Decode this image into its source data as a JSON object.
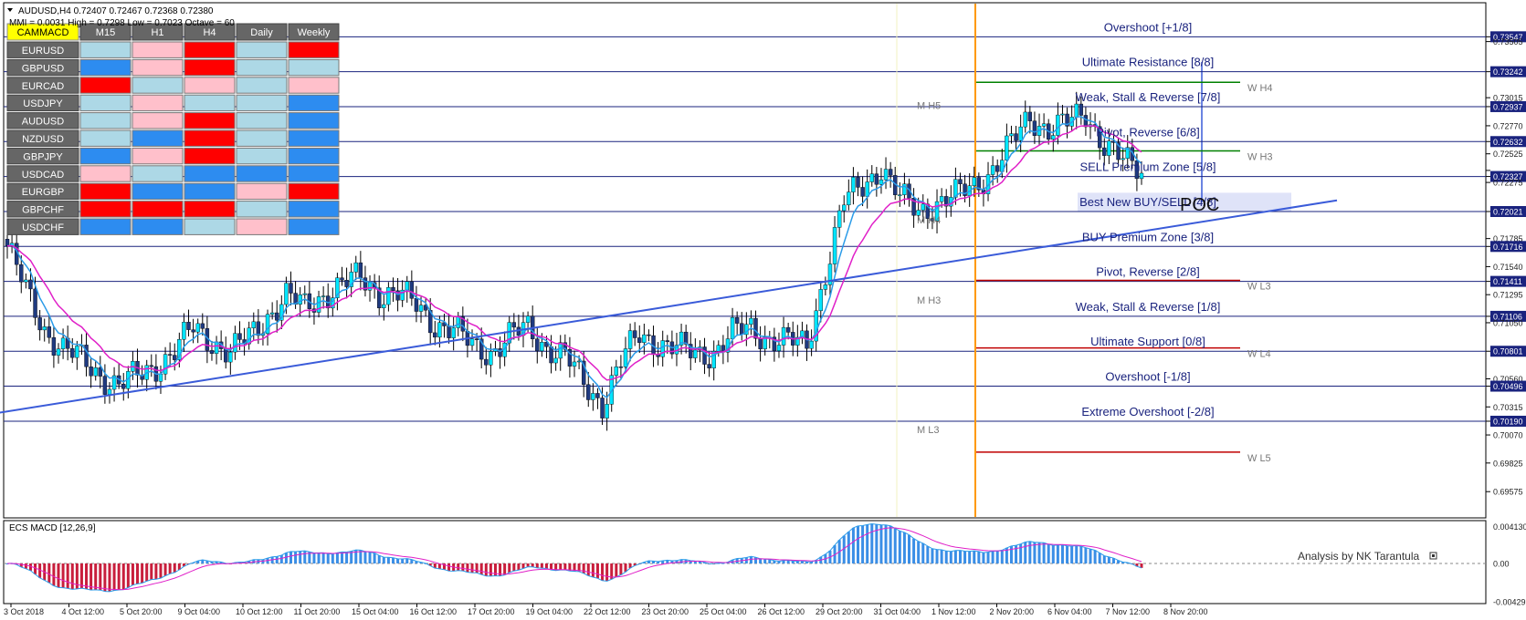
{
  "header": {
    "symbol_line": "AUDUSD,H4  0.72407 0.72467 0.72368 0.72380",
    "mmi_line": "MMI = 0.0031   High = 0.7298   Low = 0.7023   Octave = 60"
  },
  "matrix": {
    "corner_label": "CAMMACD",
    "columns": [
      "M15",
      "H1",
      "H4",
      "Daily",
      "Weekly"
    ],
    "rows": [
      {
        "pair": "EURUSD",
        "cells": [
          "lightblue",
          "pink",
          "red",
          "lightblue",
          "red"
        ]
      },
      {
        "pair": "GBPUSD",
        "cells": [
          "blue",
          "pink",
          "red",
          "lightblue",
          "lightblue"
        ]
      },
      {
        "pair": "EURCAD",
        "cells": [
          "red",
          "lightblue",
          "pink",
          "lightblue",
          "pink"
        ]
      },
      {
        "pair": "USDJPY",
        "cells": [
          "lightblue",
          "pink",
          "lightblue",
          "lightblue",
          "blue"
        ]
      },
      {
        "pair": "AUDUSD",
        "cells": [
          "lightblue",
          "pink",
          "red",
          "lightblue",
          "blue"
        ]
      },
      {
        "pair": "NZDUSD",
        "cells": [
          "lightblue",
          "blue",
          "red",
          "lightblue",
          "blue"
        ]
      },
      {
        "pair": "GBPJPY",
        "cells": [
          "blue",
          "pink",
          "red",
          "lightblue",
          "blue"
        ]
      },
      {
        "pair": "USDCAD",
        "cells": [
          "pink",
          "lightblue",
          "blue",
          "blue",
          "blue"
        ]
      },
      {
        "pair": "EURGBP",
        "cells": [
          "red",
          "blue",
          "blue",
          "pink",
          "red"
        ]
      },
      {
        "pair": "GBPCHF",
        "cells": [
          "red",
          "red",
          "red",
          "lightblue",
          "blue"
        ]
      },
      {
        "pair": "USDCHF",
        "cells": [
          "blue",
          "blue",
          "lightblue",
          "pink",
          "blue"
        ]
      }
    ]
  },
  "colors": {
    "lightblue": "#add8e6",
    "pink": "#ffc0cb",
    "red": "#ff0000",
    "blue": "#2d8cf0",
    "bull": "#00e5ff",
    "bear": "#1f3a80",
    "fast_ma": "#2b9be8",
    "slow_ma": "#e020c8",
    "murrey_line": "#1a237e",
    "trendline": "#3a5bd9",
    "vline": "#ff9900",
    "w_green": "#008000",
    "w_red": "#c00000",
    "hist_pos": "#3a8ee6",
    "hist_neg": "#c81e3c",
    "poc_zone": "#dfe3f8"
  },
  "chart_data": {
    "type": "candlestick",
    "symbol": "AUDUSD",
    "timeframe": "H4",
    "ylim": [
      0.6961,
      0.7362
    ],
    "price_ticks": [
      {
        "value": 0.73547,
        "label": "0.73547",
        "tag": true
      },
      {
        "value": 0.73505,
        "label": "0.73505",
        "tag": false
      },
      {
        "value": 0.73242,
        "label": "0.73242",
        "tag": true
      },
      {
        "value": 0.73015,
        "label": "0.73015",
        "tag": false
      },
      {
        "value": 0.72937,
        "label": "0.72937",
        "tag": true
      },
      {
        "value": 0.7277,
        "label": "0.72770",
        "tag": false
      },
      {
        "value": 0.72632,
        "label": "0.72632",
        "tag": true
      },
      {
        "value": 0.72525,
        "label": "0.72525",
        "tag": false
      },
      {
        "value": 0.7238,
        "label": "0.72380",
        "tag": true
      },
      {
        "value": 0.72327,
        "label": "0.72327",
        "tag": true
      },
      {
        "value": 0.72275,
        "label": "0.72275",
        "tag": false
      },
      {
        "value": 0.72021,
        "label": "0.72021",
        "tag": true
      },
      {
        "value": 0.71785,
        "label": "0.71785",
        "tag": false
      },
      {
        "value": 0.71716,
        "label": "0.71716",
        "tag": true
      },
      {
        "value": 0.7154,
        "label": "0.71540",
        "tag": false
      },
      {
        "value": 0.71411,
        "label": "0.71411",
        "tag": true
      },
      {
        "value": 0.71295,
        "label": "0.71295",
        "tag": false
      },
      {
        "value": 0.71106,
        "label": "0.71106",
        "tag": true
      },
      {
        "value": 0.7105,
        "label": "0.71050",
        "tag": false
      },
      {
        "value": 0.70801,
        "label": "0.70801",
        "tag": true
      },
      {
        "value": 0.7056,
        "label": "0.70560",
        "tag": false
      },
      {
        "value": 0.70496,
        "label": "0.70496",
        "tag": true
      },
      {
        "value": 0.70315,
        "label": "0.70315",
        "tag": false
      },
      {
        "value": 0.7019,
        "label": "0.70190",
        "tag": true
      },
      {
        "value": 0.7007,
        "label": "0.70070",
        "tag": false
      },
      {
        "value": 0.69825,
        "label": "0.69825",
        "tag": false
      },
      {
        "value": 0.69575,
        "label": "0.69575",
        "tag": false
      }
    ],
    "murrey_levels": [
      {
        "label": "Overshoot [+1/8]",
        "value": 0.73547
      },
      {
        "label": "Ultimate Resistance [8/8]",
        "value": 0.73242
      },
      {
        "label": "Weak, Stall & Reverse [7/8]",
        "value": 0.72937
      },
      {
        "label": "Pivot, Reverse [6/8]",
        "value": 0.72632
      },
      {
        "label": "SELL Premium Zone [5/8]",
        "value": 0.72327
      },
      {
        "label": "Best New BUY/SELL [4/8]",
        "value": 0.72021
      },
      {
        "label": "BUY Premium Zone [3/8]",
        "value": 0.71716
      },
      {
        "label": "Pivot, Reverse [2/8]",
        "value": 0.71411
      },
      {
        "label": "Weak, Stall & Reverse [1/8]",
        "value": 0.71106
      },
      {
        "label": "Ultimate Support [0/8]",
        "value": 0.70801
      },
      {
        "label": "Overshoot [-1/8]",
        "value": 0.70496
      },
      {
        "label": "Extreme Overshoot [-2/8]",
        "value": 0.7019
      }
    ],
    "weekly_levels": [
      {
        "label": "W H4",
        "value": 0.7315,
        "color": "green"
      },
      {
        "label": "W H3",
        "value": 0.7255,
        "color": "green"
      },
      {
        "label": "W L3",
        "value": 0.7142,
        "color": "red"
      },
      {
        "label": "W L4",
        "value": 0.7083,
        "color": "red"
      },
      {
        "label": "W L5",
        "value": 0.6992,
        "color": "red"
      }
    ],
    "monthly_labels": [
      {
        "label": "M H5",
        "value": 0.7295
      },
      {
        "label": "M H4",
        "value": 0.7195
      },
      {
        "label": "M H3",
        "value": 0.7125
      },
      {
        "label": "M L3",
        "value": 0.7012
      }
    ],
    "poc_label": "POC",
    "poc_zone": [
      0.72021,
      0.72185
    ],
    "trendline": {
      "from": [
        "26 Oct 04:00",
        0.7018
      ],
      "to": [
        "8 Nov 20:00",
        0.7215
      ]
    },
    "current_price": 0.7238,
    "x_labels": [
      "3 Oct 2018",
      "4 Oct 12:00",
      "5 Oct 20:00",
      "9 Oct 04:00",
      "10 Oct 12:00",
      "11 Oct 20:00",
      "15 Oct 04:00",
      "16 Oct 12:00",
      "17 Oct 20:00",
      "19 Oct 04:00",
      "22 Oct 12:00",
      "23 Oct 20:00",
      "25 Oct 04:00",
      "26 Oct 12:00",
      "29 Oct 20:00",
      "31 Oct 04:00",
      "1 Nov 12:00",
      "2 Nov 20:00",
      "6 Nov 04:00",
      "7 Nov 12:00",
      "8 Nov 20:00"
    ],
    "close_path": [
      [
        0,
        0.7172
      ],
      [
        4,
        0.7132
      ],
      [
        8,
        0.71
      ],
      [
        12,
        0.7082
      ],
      [
        16,
        0.7072
      ],
      [
        20,
        0.706
      ],
      [
        24,
        0.705
      ],
      [
        28,
        0.7058
      ],
      [
        32,
        0.7068
      ],
      [
        36,
        0.708
      ],
      [
        40,
        0.71
      ],
      [
        44,
        0.709
      ],
      [
        48,
        0.7078
      ],
      [
        52,
        0.7092
      ],
      [
        56,
        0.7112
      ],
      [
        60,
        0.7128
      ],
      [
        64,
        0.7118
      ],
      [
        68,
        0.713
      ],
      [
        72,
        0.7138
      ],
      [
        76,
        0.7144
      ],
      [
        80,
        0.7132
      ],
      [
        84,
        0.713
      ],
      [
        88,
        0.712
      ],
      [
        92,
        0.7105
      ],
      [
        96,
        0.7098
      ],
      [
        100,
        0.7085
      ],
      [
        104,
        0.708
      ],
      [
        108,
        0.7092
      ],
      [
        112,
        0.71
      ],
      [
        116,
        0.7085
      ],
      [
        120,
        0.7075
      ],
      [
        124,
        0.7052
      ],
      [
        128,
        0.7035
      ],
      [
        132,
        0.707
      ],
      [
        136,
        0.7095
      ],
      [
        140,
        0.7088
      ],
      [
        144,
        0.7082
      ],
      [
        148,
        0.7078
      ],
      [
        152,
        0.708
      ],
      [
        156,
        0.7095
      ],
      [
        160,
        0.71
      ],
      [
        164,
        0.7092
      ],
      [
        168,
        0.7088
      ],
      [
        172,
        0.7085
      ],
      [
        176,
        0.715
      ],
      [
        180,
        0.721
      ],
      [
        184,
        0.7225
      ],
      [
        188,
        0.7242
      ],
      [
        192,
        0.7213
      ],
      [
        196,
        0.7203
      ],
      [
        200,
        0.721
      ],
      [
        204,
        0.7215
      ],
      [
        208,
        0.7225
      ],
      [
        212,
        0.724
      ],
      [
        216,
        0.726
      ],
      [
        220,
        0.7285
      ],
      [
        224,
        0.7275
      ],
      [
        228,
        0.7278
      ],
      [
        232,
        0.7288
      ],
      [
        236,
        0.7262
      ],
      [
        240,
        0.7245
      ],
      [
        244,
        0.7238
      ]
    ],
    "macd": {
      "label": "ECS MACD [12,26,9]",
      "ylim": [
        -0.0043,
        0.0043
      ],
      "ticks": [
        {
          "value": 0.00413,
          "label": "0.004130"
        },
        {
          "value": 0.0,
          "label": "0.00"
        },
        {
          "value": -0.00429,
          "label": "-0.004299"
        }
      ]
    }
  },
  "watermark": "Analysis by NK Tarantula"
}
